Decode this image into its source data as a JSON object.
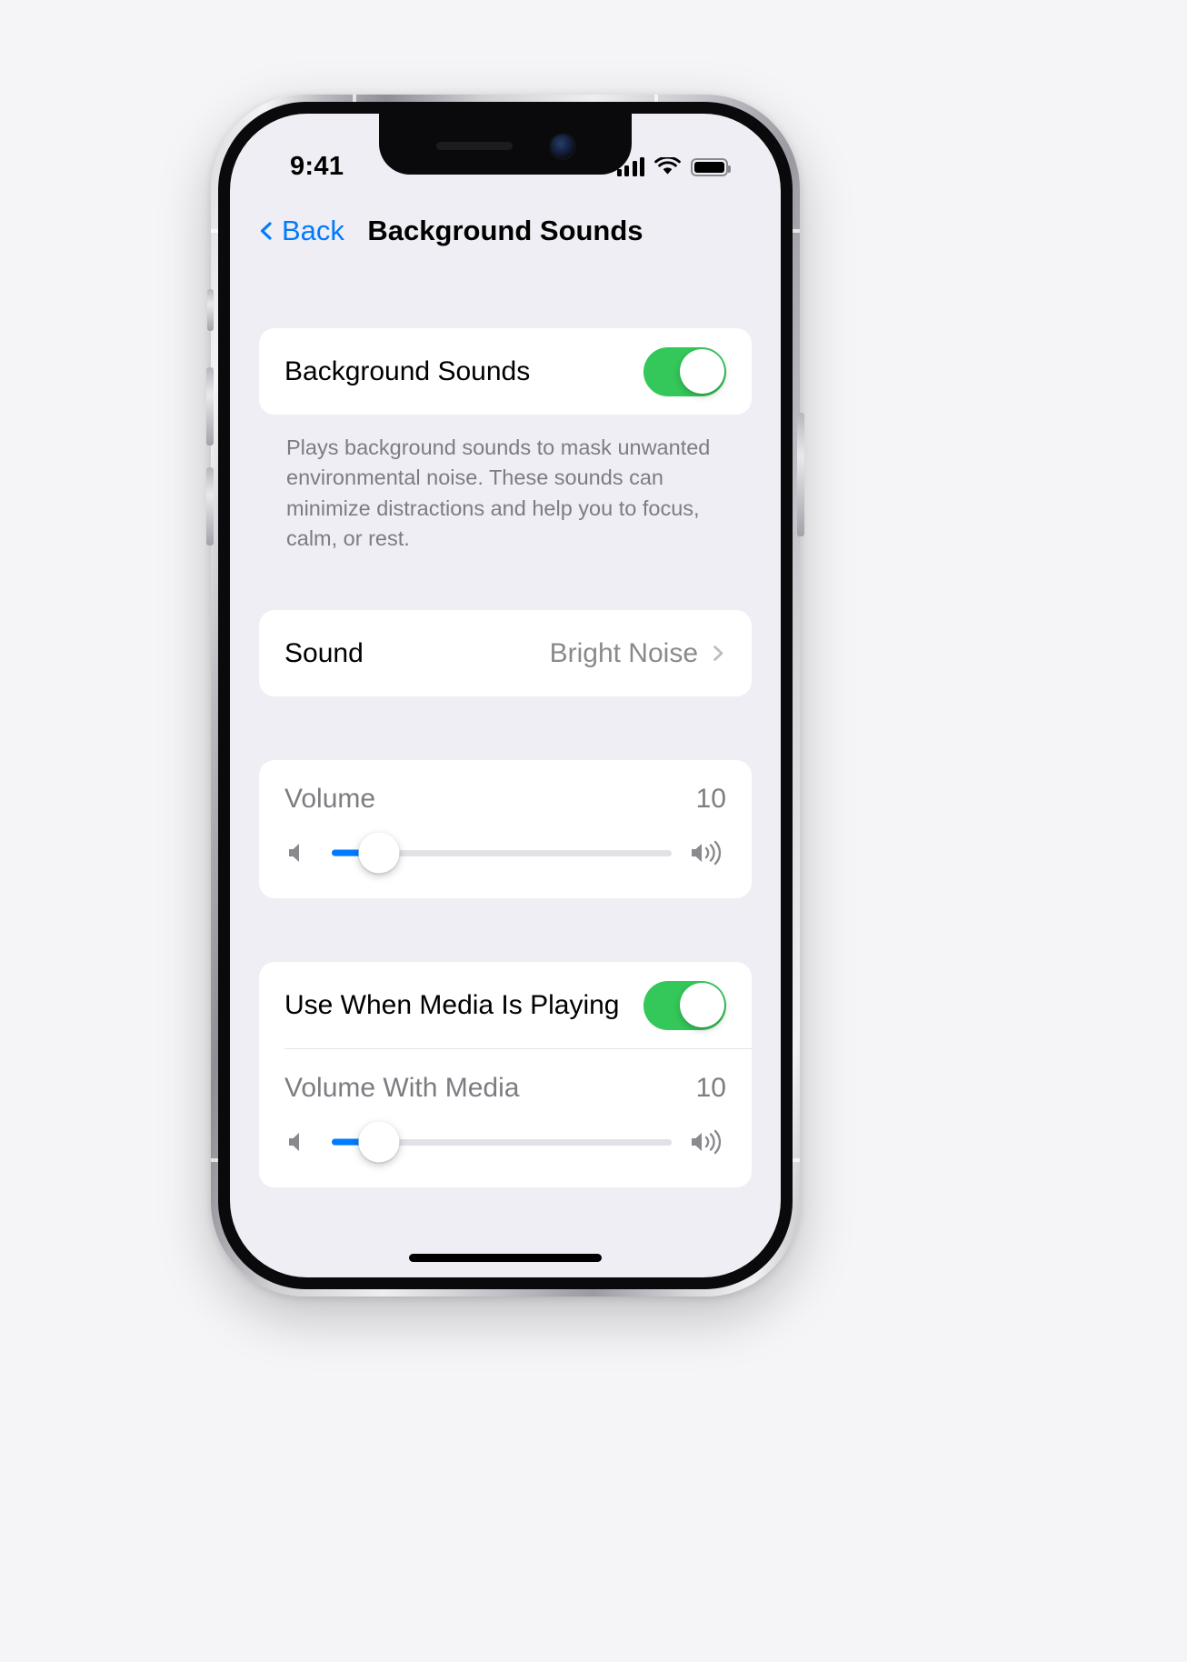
{
  "status_bar": {
    "time": "9:41",
    "signal_icon": "cellular-signal-icon",
    "wifi_icon": "wifi-icon",
    "battery_icon": "battery-icon"
  },
  "nav": {
    "back_label": "Back",
    "title": "Background Sounds"
  },
  "sections": {
    "main_toggle": {
      "label": "Background Sounds",
      "enabled": true,
      "footnote": "Plays background sounds to mask unwanted environmental noise. These sounds can minimize distractions and help you to focus, calm, or rest."
    },
    "sound": {
      "label": "Sound",
      "value": "Bright Noise"
    },
    "volume": {
      "label": "Volume",
      "value": "10",
      "percent": 14
    },
    "media": {
      "toggle_label": "Use When Media Is Playing",
      "enabled": true,
      "volume_label": "Volume With Media",
      "volume_value": "10",
      "percent": 14
    }
  },
  "colors": {
    "accent_blue": "#007aff",
    "toggle_green": "#34c759",
    "screen_background": "#efeef4",
    "card_background": "#ffffff",
    "secondary_text": "#7c7c82"
  }
}
